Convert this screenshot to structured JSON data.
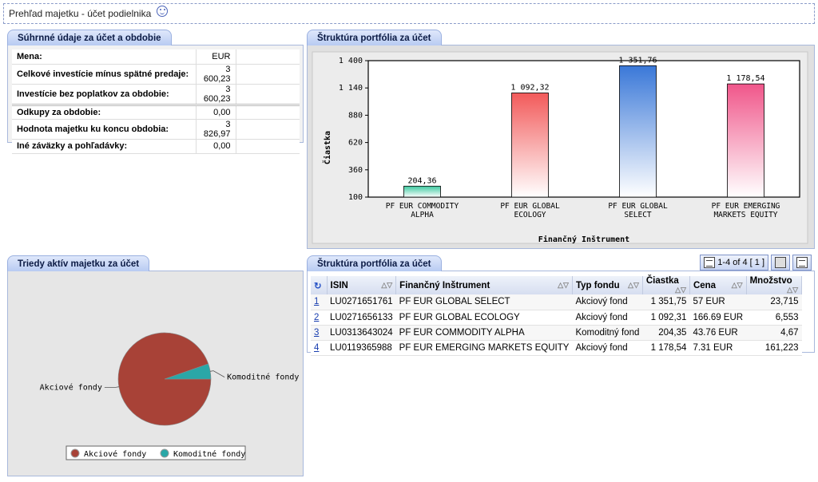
{
  "header": {
    "title": "Prehľad majetku - účet podielnika"
  },
  "summary": {
    "tab": "Súhrnné údaje za účet a obdobie",
    "rows": [
      {
        "label": "Mena:",
        "value": "EUR"
      },
      {
        "label": "Celkové investície mínus spätné predaje:",
        "value": "3 600,23"
      },
      {
        "label": "Investície bez poplatkov za obdobie:",
        "value": "3 600,23"
      },
      {
        "label": "Odkupy za obdobie:",
        "value": "0,00"
      },
      {
        "label": "Hodnota majetku ku koncu obdobia:",
        "value": "3 826,97"
      },
      {
        "label": "Iné záväzky a pohľadávky:",
        "value": "0,00"
      }
    ]
  },
  "structure_chart": {
    "tab": "Štruktúra portfólia za účet",
    "ylabel": "Čiastka",
    "xlabel": "Finančný Inštrument"
  },
  "asset_classes": {
    "tab": "Triedy aktív majetku za účet"
  },
  "portfolio": {
    "tab": "Štruktúra portfólia za účet",
    "pager": "1-4 of 4 [ 1 ]",
    "columns": [
      "ISIN",
      "Finančný Inštrument",
      "Typ fondu",
      "Čiastka",
      "Cena",
      "Množstvo"
    ],
    "rows": [
      {
        "n": "1",
        "isin": "LU0271651761",
        "name": "PF EUR GLOBAL SELECT",
        "type": "Akciový fond",
        "amount": "1 351,75",
        "price": "57 EUR",
        "qty": "23,715"
      },
      {
        "n": "2",
        "isin": "LU0271656133",
        "name": "PF EUR GLOBAL ECOLOGY",
        "type": "Akciový fond",
        "amount": "1 092,31",
        "price": "166.69 EUR",
        "qty": "6,553"
      },
      {
        "n": "3",
        "isin": "LU0313643024",
        "name": "PF EUR COMMODITY ALPHA",
        "type": "Komoditný fond",
        "amount": "204,35",
        "price": "43.76 EUR",
        "qty": "4,67"
      },
      {
        "n": "4",
        "isin": "LU0119365988",
        "name": "PF EUR EMERGING MARKETS EQUITY",
        "type": "Akciový fond",
        "amount": "1 178,54",
        "price": "7.31 EUR",
        "qty": "161,223"
      }
    ]
  },
  "chart_data": [
    {
      "type": "bar",
      "categories": [
        "PF EUR COMMODITY ALPHA",
        "PF EUR GLOBAL ECOLOGY",
        "PF EUR GLOBAL SELECT",
        "PF EUR EMERGING MARKETS EQUITY"
      ],
      "values": [
        204.36,
        1092.32,
        1351.76,
        1178.54
      ],
      "value_labels": [
        "204,36",
        "1 092,32",
        "1 351,76",
        "1 178,54"
      ],
      "ylabel": "Čiastka",
      "xlabel": "Finančný Inštrument",
      "yticks": [
        "100",
        "360",
        "620",
        "880",
        "1 140",
        "1 400"
      ],
      "ylim": [
        100,
        1400
      ],
      "colors": [
        "#3cc9a0",
        "#f25a5a",
        "#3a78d8",
        "#f0568a"
      ]
    },
    {
      "type": "pie",
      "labels": [
        "Akciové fondy",
        "Komoditné fondy"
      ],
      "values": [
        3622.61,
        204.36
      ],
      "colors": [
        "#a84237",
        "#2aa7a7"
      ],
      "legend": "bottom"
    }
  ]
}
